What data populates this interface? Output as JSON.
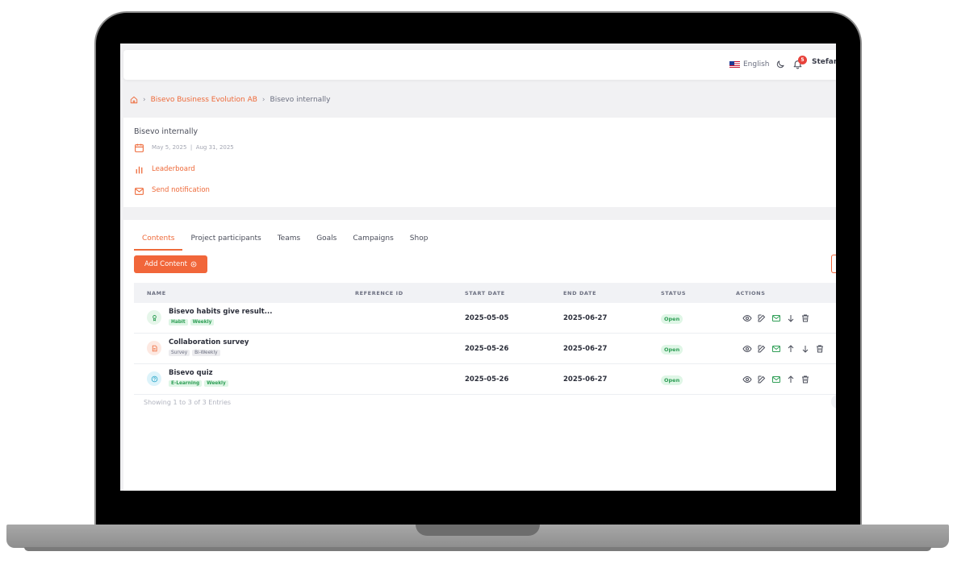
{
  "header": {
    "language": "English",
    "notification_count": "5",
    "user_name": "Stefan"
  },
  "breadcrumb": {
    "items": [
      "Bisevo Business Evolution AB",
      "Bisevo internally"
    ]
  },
  "project": {
    "title": "Bisevo internally",
    "start_date": "May 5, 2025",
    "end_date": "Aug 31, 2025",
    "date_separator": "|",
    "leaderboard_label": "Leaderboard",
    "send_notification_label": "Send notification"
  },
  "tabs": [
    "Contents",
    "Project participants",
    "Teams",
    "Goals",
    "Campaigns",
    "Shop"
  ],
  "add_content_label": "Add Content",
  "table": {
    "columns": [
      "NAME",
      "REFERENCE ID",
      "START DATE",
      "END DATE",
      "STATUS",
      "ACTIONS"
    ],
    "rows": [
      {
        "name": "Bisevo habits give result...",
        "tags": [
          "Habit",
          "Weekly"
        ],
        "reference_id": "",
        "start": "2025-05-05",
        "end": "2025-06-27",
        "status": "Open"
      },
      {
        "name": "Collaboration survey",
        "tags": [
          "Survey",
          "Bi-Weekly"
        ],
        "reference_id": "",
        "start": "2025-05-26",
        "end": "2025-06-27",
        "status": "Open"
      },
      {
        "name": "Bisevo quiz",
        "tags": [
          "E-Learning",
          "Weekly"
        ],
        "reference_id": "",
        "start": "2025-05-26",
        "end": "2025-06-27",
        "status": "Open"
      }
    ]
  },
  "footer_text": "Showing 1 to 3 of 3 Entries",
  "colors": {
    "accent": "#f1663a",
    "status_open": "#2f9e56",
    "badge": "#e8423b"
  }
}
